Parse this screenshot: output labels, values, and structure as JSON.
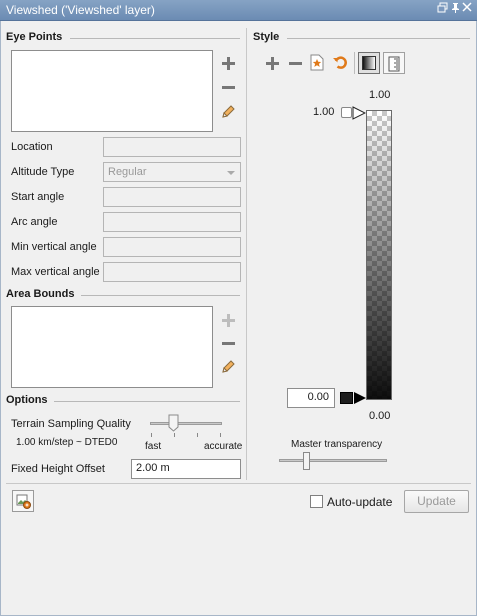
{
  "window": {
    "title": "Viewshed ('Viewshed' layer)"
  },
  "eye_points": {
    "title": "Eye Points",
    "fields": [
      {
        "label": "Location",
        "value": ""
      },
      {
        "label": "Altitude Type",
        "value": "Regular"
      },
      {
        "label": "Start angle",
        "value": ""
      },
      {
        "label": "Arc angle",
        "value": ""
      },
      {
        "label": "Min vertical angle",
        "value": ""
      },
      {
        "label": "Max vertical angle",
        "value": ""
      }
    ]
  },
  "area_bounds": {
    "title": "Area Bounds"
  },
  "options": {
    "title": "Options",
    "terrain_label": "Terrain Sampling Quality",
    "terrain_value": "1.00 km/step ~ DTED0",
    "terrain_fast": "fast",
    "terrain_accurate": "accurate",
    "terrain_level": 0.33,
    "height_label": "Fixed Height Offset",
    "height_value": "2.00 m"
  },
  "style": {
    "title": "Style",
    "ramp_top_label": "1.00",
    "ramp_bottom_label": "0.00",
    "handle_top_value": "1.00",
    "handle_bottom_value": "0.00",
    "master_transparency_label": "Master transparency",
    "master_transparency_level": 0.25
  },
  "footer": {
    "auto_update_label": "Auto-update",
    "auto_update_checked": false,
    "update_label": "Update"
  }
}
